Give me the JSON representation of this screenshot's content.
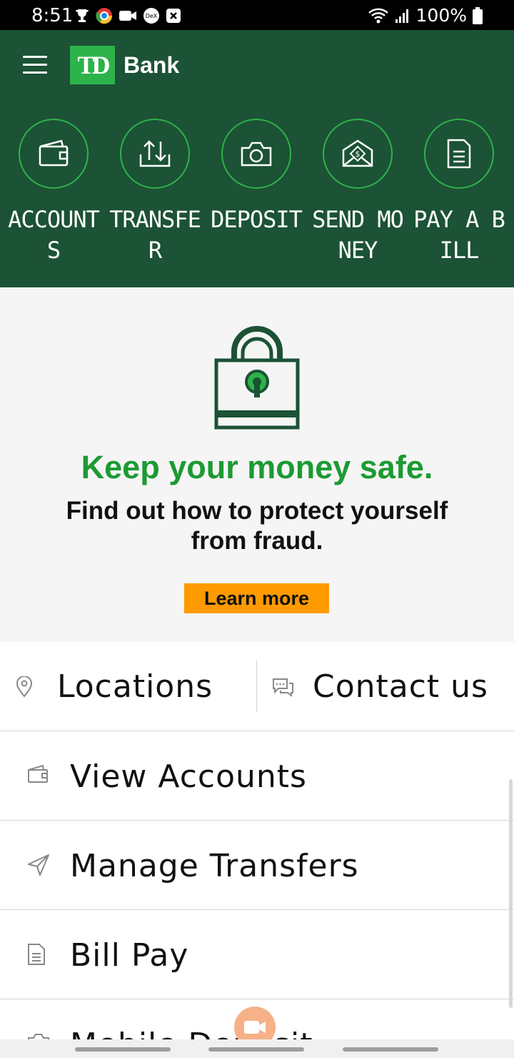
{
  "status_bar": {
    "time": "8:51",
    "battery": "100%"
  },
  "header": {
    "logo_text": "TD",
    "brand": "Bank",
    "colors": {
      "background": "#1c5236",
      "accent": "#2db34a"
    }
  },
  "quick_actions": [
    {
      "label": "ACCOUNTS",
      "icon": "wallet-icon"
    },
    {
      "label": "TRANSFER",
      "icon": "transfer-icon"
    },
    {
      "label": "DEPOSIT",
      "icon": "camera-icon"
    },
    {
      "label": "SEND MONEY",
      "icon": "envelope-dollar-icon"
    },
    {
      "label": "PAY A BILL",
      "icon": "bill-document-icon"
    }
  ],
  "promo": {
    "icon": "padlock-icon",
    "headline": "Keep your money safe.",
    "subtext": "Find out how to protect yourself from fraud.",
    "button_label": "Learn more",
    "colors": {
      "headline": "#1c9a32",
      "button": "#ff9a00"
    }
  },
  "quick_links": [
    {
      "label": "Locations",
      "icon": "location-pin-icon"
    },
    {
      "label": "Contact us",
      "icon": "chat-bubbles-icon"
    }
  ],
  "menu": [
    {
      "label": "View Accounts",
      "icon": "wallet-icon"
    },
    {
      "label": "Manage Transfers",
      "icon": "paper-plane-icon"
    },
    {
      "label": "Bill Pay",
      "icon": "document-icon"
    },
    {
      "label": "Mobile Deposit",
      "icon": "camera-icon"
    }
  ]
}
